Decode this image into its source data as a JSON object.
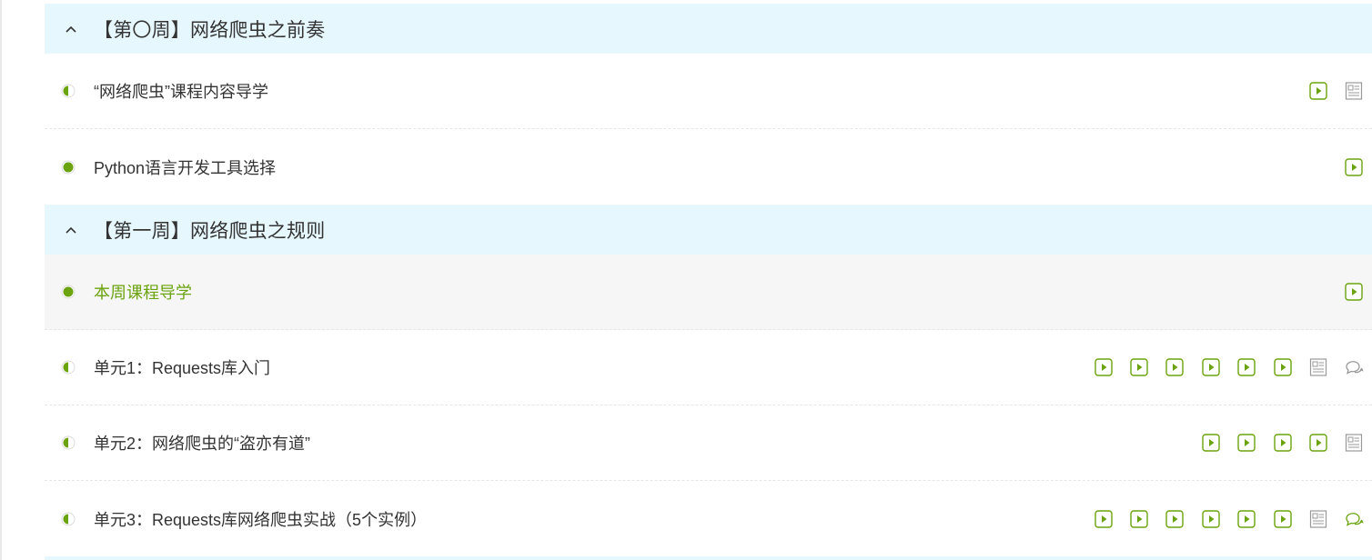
{
  "colors": {
    "accent": "#6ba30f",
    "chapter_bg": "#e6f7fd",
    "active_bg": "#f6f6f6",
    "text": "#333333",
    "icon_gray": "#999999"
  },
  "chapters": [
    {
      "title": "【第〇周】网络爬虫之前奏",
      "icon": "chevron-up-icon",
      "lessons": [
        {
          "title": "“网络爬虫”课程内容导学",
          "status": "half",
          "units": [
            "video",
            "doc"
          ]
        },
        {
          "title": "Python语言开发工具选择",
          "status": "done",
          "units": [
            "video"
          ]
        }
      ]
    },
    {
      "title": "【第一周】网络爬虫之规则",
      "icon": "chevron-up-icon",
      "lessons": [
        {
          "title": "本周课程导学",
          "status": "done",
          "active": true,
          "units": [
            "video"
          ]
        },
        {
          "title": "单元1：Requests库入门",
          "status": "half",
          "units": [
            "video",
            "video",
            "video",
            "video",
            "video",
            "video",
            "doc",
            "discussion"
          ]
        },
        {
          "title": "单元2：网络爬虫的“盗亦有道”",
          "status": "half",
          "units": [
            "video",
            "video",
            "video",
            "video",
            "doc"
          ]
        },
        {
          "title": "单元3：Requests库网络爬虫实战（5个实例）",
          "status": "half",
          "units": [
            "video",
            "video",
            "video",
            "video",
            "video",
            "video",
            "doc",
            "discussion-active"
          ]
        }
      ]
    }
  ]
}
